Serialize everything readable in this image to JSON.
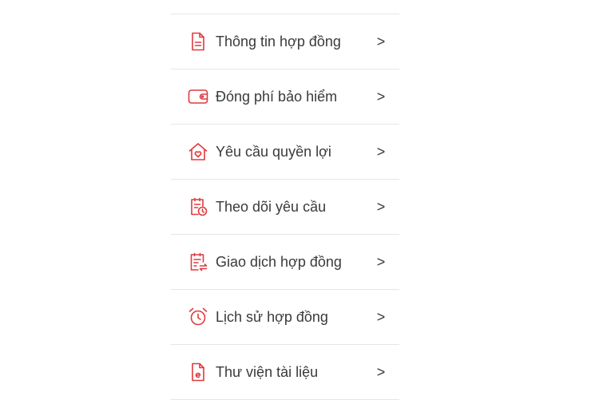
{
  "accent_color": "#e03a3e",
  "menu": {
    "items": [
      {
        "label": "Thông tin hợp đồng",
        "icon": "document-icon",
        "chevron": ">"
      },
      {
        "label": "Đóng phí bảo hiểm",
        "icon": "wallet-icon",
        "chevron": ">"
      },
      {
        "label": "Yêu cầu quyền lợi",
        "icon": "house-heart-icon",
        "chevron": ">"
      },
      {
        "label": "Theo dõi yêu cầu",
        "icon": "clipboard-clock-icon",
        "chevron": ">"
      },
      {
        "label": "Giao dịch hợp đồng",
        "icon": "notes-transfer-icon",
        "chevron": ">"
      },
      {
        "label": "Lịch sử hợp đồng",
        "icon": "alarm-clock-icon",
        "chevron": ">"
      },
      {
        "label": "Thư viện tài liệu",
        "icon": "file-e-icon",
        "chevron": ">"
      }
    ]
  }
}
